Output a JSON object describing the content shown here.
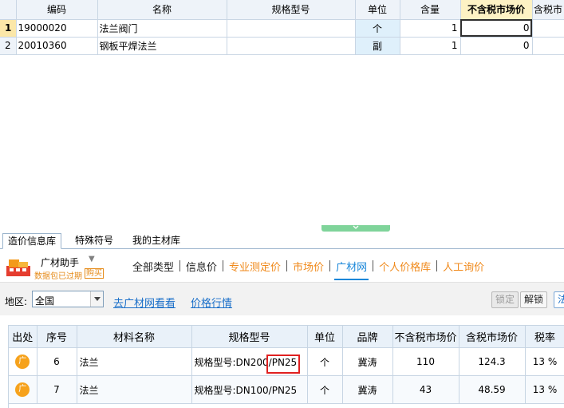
{
  "grid": {
    "headers": [
      "编码",
      "名称",
      "规格型号",
      "单位",
      "含量",
      "不含税市场价",
      "含税市"
    ],
    "rows": [
      {
        "rn": "1",
        "code": "19000020",
        "name": "法兰阀门",
        "spec": "",
        "unit": "个",
        "qty": "1",
        "price": "0",
        "tax_price": ""
      },
      {
        "rn": "2",
        "code": "20010360",
        "name": "钢板平焊法兰",
        "spec": "",
        "unit": "副",
        "qty": "1",
        "price": "0",
        "tax_price": ""
      }
    ]
  },
  "bottom_tabs": [
    "造价信息库",
    "特殊符号",
    "我的主材库"
  ],
  "helper": {
    "title": "广材助手",
    "expired": "数据包已过期",
    "buy": "购买"
  },
  "nav": {
    "items": [
      "全部类型",
      "信息价",
      "专业测定价",
      "市场价",
      "广材网",
      "个人价格库",
      "人工询价"
    ]
  },
  "filter": {
    "region_label": "地区:",
    "region_value": "全国",
    "link_visit": "去广材网看看",
    "link_trend": "价格行情",
    "lock": "锁定",
    "unlock": "解锁",
    "cut": "法"
  },
  "results": {
    "headers": [
      "出处",
      "序号",
      "材料名称",
      "规格型号",
      "单位",
      "品牌",
      "不含税市场价",
      "含税市场价",
      "税率"
    ],
    "source_icon": "广",
    "rows": [
      {
        "seq": "6",
        "name": "法兰",
        "spec": "规格型号:DN200/PN25",
        "unit": "个",
        "brand": "冀涛",
        "price": "110",
        "tax_price": "124.3",
        "rate": "13 %"
      },
      {
        "seq": "7",
        "name": "法兰",
        "spec": "规格型号:DN100/PN25",
        "unit": "个",
        "brand": "冀涛",
        "price": "43",
        "tax_price": "48.59",
        "rate": "13 %"
      }
    ]
  }
}
